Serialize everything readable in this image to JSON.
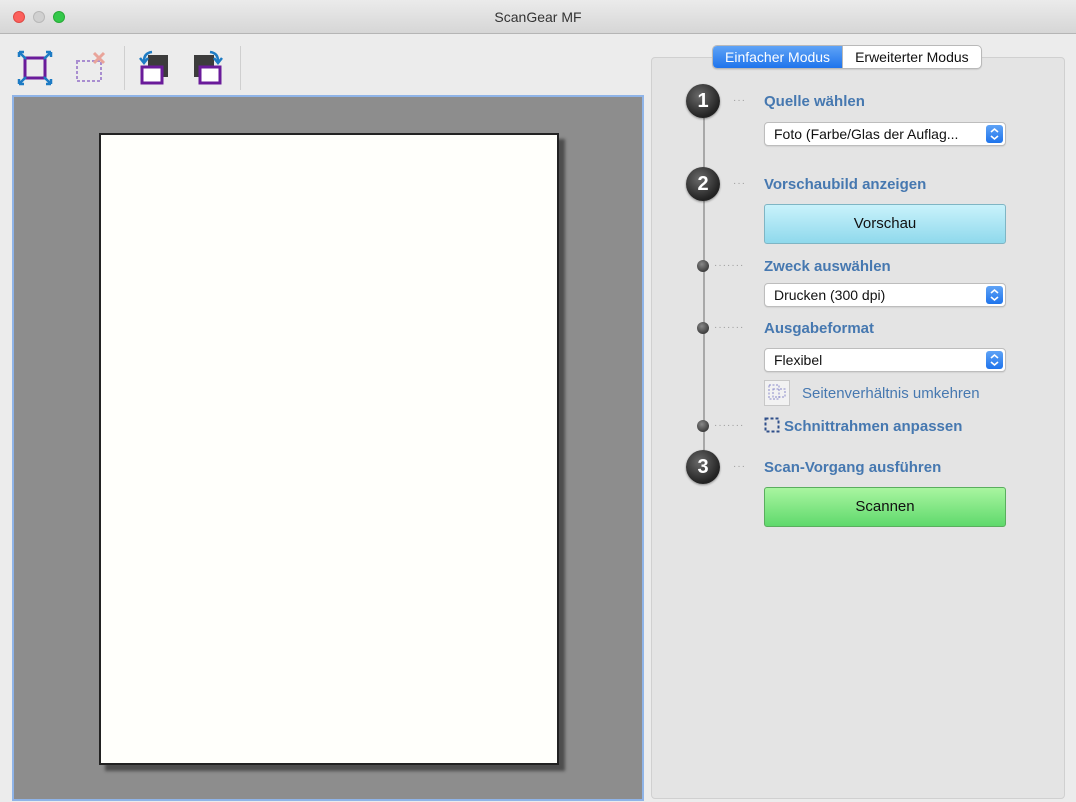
{
  "window": {
    "title": "ScanGear MF"
  },
  "toolbar": {
    "tools": [
      {
        "icon": "auto-crop-icon"
      },
      {
        "icon": "remove-crop-frame-icon"
      },
      {
        "icon": "rotate-left-icon"
      },
      {
        "icon": "rotate-right-icon"
      }
    ]
  },
  "tabs": [
    {
      "label": "Einfacher Modus",
      "active": true
    },
    {
      "label": "Erweiterter Modus",
      "active": false
    }
  ],
  "steps": {
    "source": {
      "number": "1",
      "label": "Quelle wählen",
      "value": "Foto (Farbe/Glas der Auflag..."
    },
    "preview": {
      "number": "2",
      "label": "Vorschaubild anzeigen",
      "button": "Vorschau"
    },
    "purpose": {
      "label": "Zweck auswählen",
      "value": "Drucken (300 dpi)"
    },
    "output": {
      "label": "Ausgabeformat",
      "value": "Flexibel",
      "invert_ratio": "Seitenverhältnis umkehren"
    },
    "crop": {
      "label": "Schnittrahmen anpassen"
    },
    "scan": {
      "number": "3",
      "label": "Scan-Vorgang ausführen",
      "button": "Scannen"
    }
  },
  "colors": {
    "accent": "#1f74ec",
    "link_text": "#4678b0",
    "preview_button": "#8fd9ec",
    "scan_button": "#5fd96c",
    "preview_area": "#8d8d8d"
  }
}
